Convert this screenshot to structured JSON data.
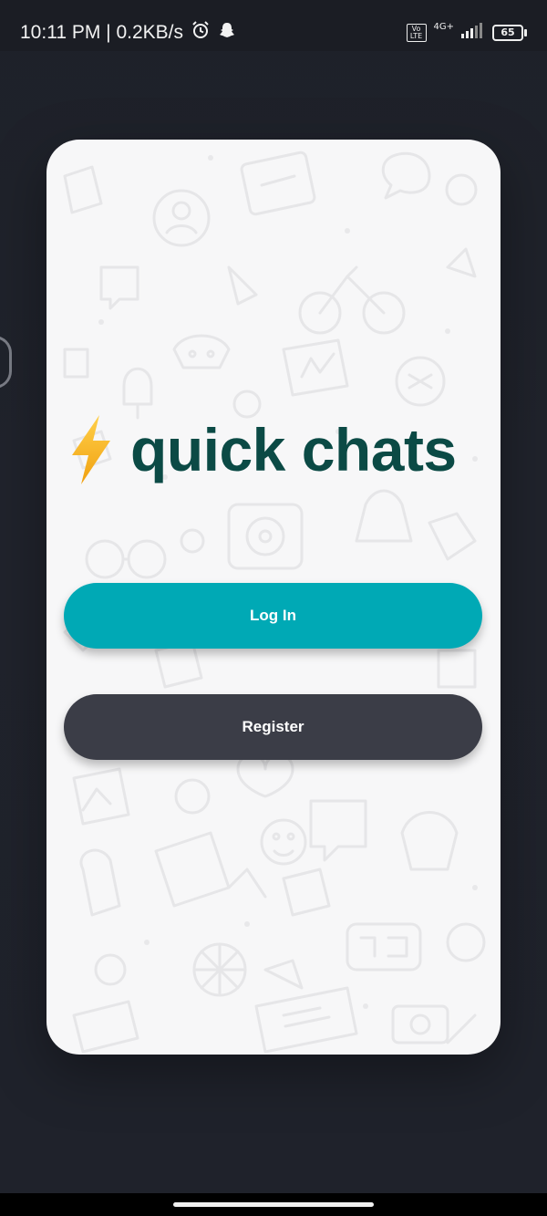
{
  "status_bar": {
    "time_speed": "10:11 PM | 0.2KB/s",
    "volte": "Vo LTE",
    "network": "4G+",
    "battery": "65"
  },
  "app": {
    "title": "quick chats",
    "logo_icon": "lightning-bolt-icon"
  },
  "buttons": {
    "login_label": "Log In",
    "register_label": "Register"
  },
  "colors": {
    "background": "#1f222b",
    "card": "#f7f7f8",
    "title": "#0b4a45",
    "login": "#00a9b5",
    "register": "#3b3d47",
    "bolt": "#f5b41a"
  }
}
